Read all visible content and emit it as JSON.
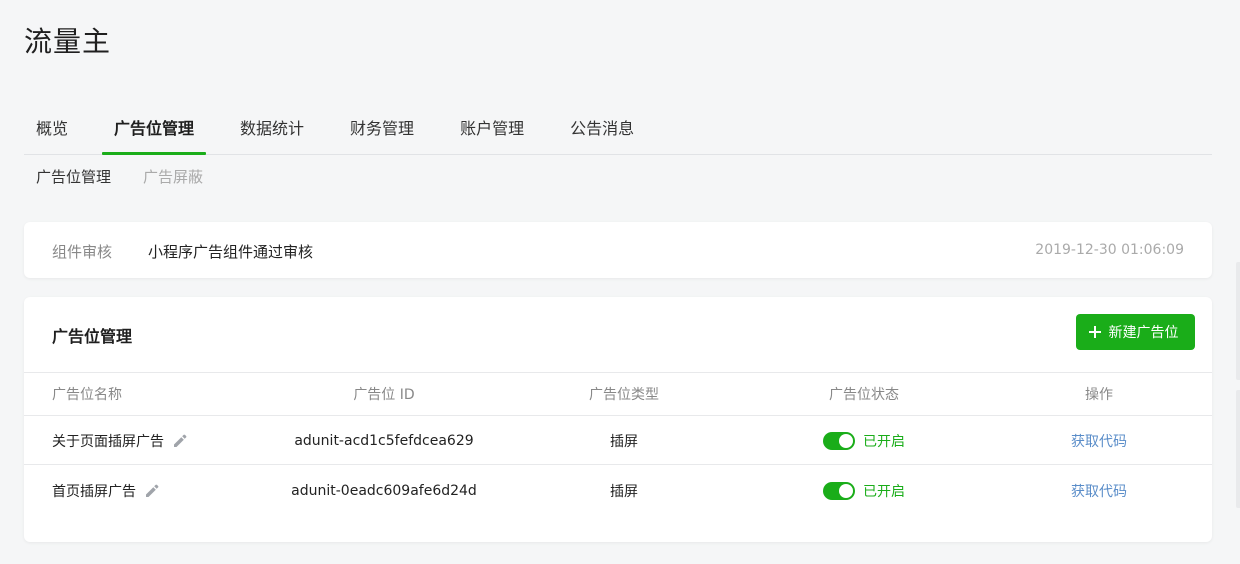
{
  "app": {
    "title": "流量主"
  },
  "main_tabs": [
    {
      "label": "概览",
      "active": false
    },
    {
      "label": "广告位管理",
      "active": true
    },
    {
      "label": "数据统计",
      "active": false
    },
    {
      "label": "财务管理",
      "active": false
    },
    {
      "label": "账户管理",
      "active": false
    },
    {
      "label": "公告消息",
      "active": false
    }
  ],
  "sub_tabs": [
    {
      "label": "广告位管理",
      "active": true
    },
    {
      "label": "广告屏蔽",
      "active": false
    }
  ],
  "notice": {
    "label": "组件审核",
    "text": "小程序广告组件通过审核",
    "time": "2019-12-30 01:06:09"
  },
  "ad_manage": {
    "title": "广告位管理",
    "new_button_label": "新建广告位",
    "columns": {
      "name": "广告位名称",
      "id": "广告位 ID",
      "type": "广告位类型",
      "status": "广告位状态",
      "action": "操作"
    },
    "rows": [
      {
        "name": "关于页面插屏广告",
        "id": "adunit-acd1c5fefdcea629",
        "type": "插屏",
        "status": "已开启",
        "enabled": true,
        "action": "获取代码"
      },
      {
        "name": "首页插屏广告",
        "id": "adunit-0eadc609afe6d24d",
        "type": "插屏",
        "status": "已开启",
        "enabled": true,
        "action": "获取代码"
      }
    ]
  },
  "icons": {
    "add": "plus-icon",
    "edit": "pencil-icon"
  },
  "colors": {
    "accent": "#1aad19",
    "link": "#5a8dc9",
    "background": "#f5f6f7"
  }
}
